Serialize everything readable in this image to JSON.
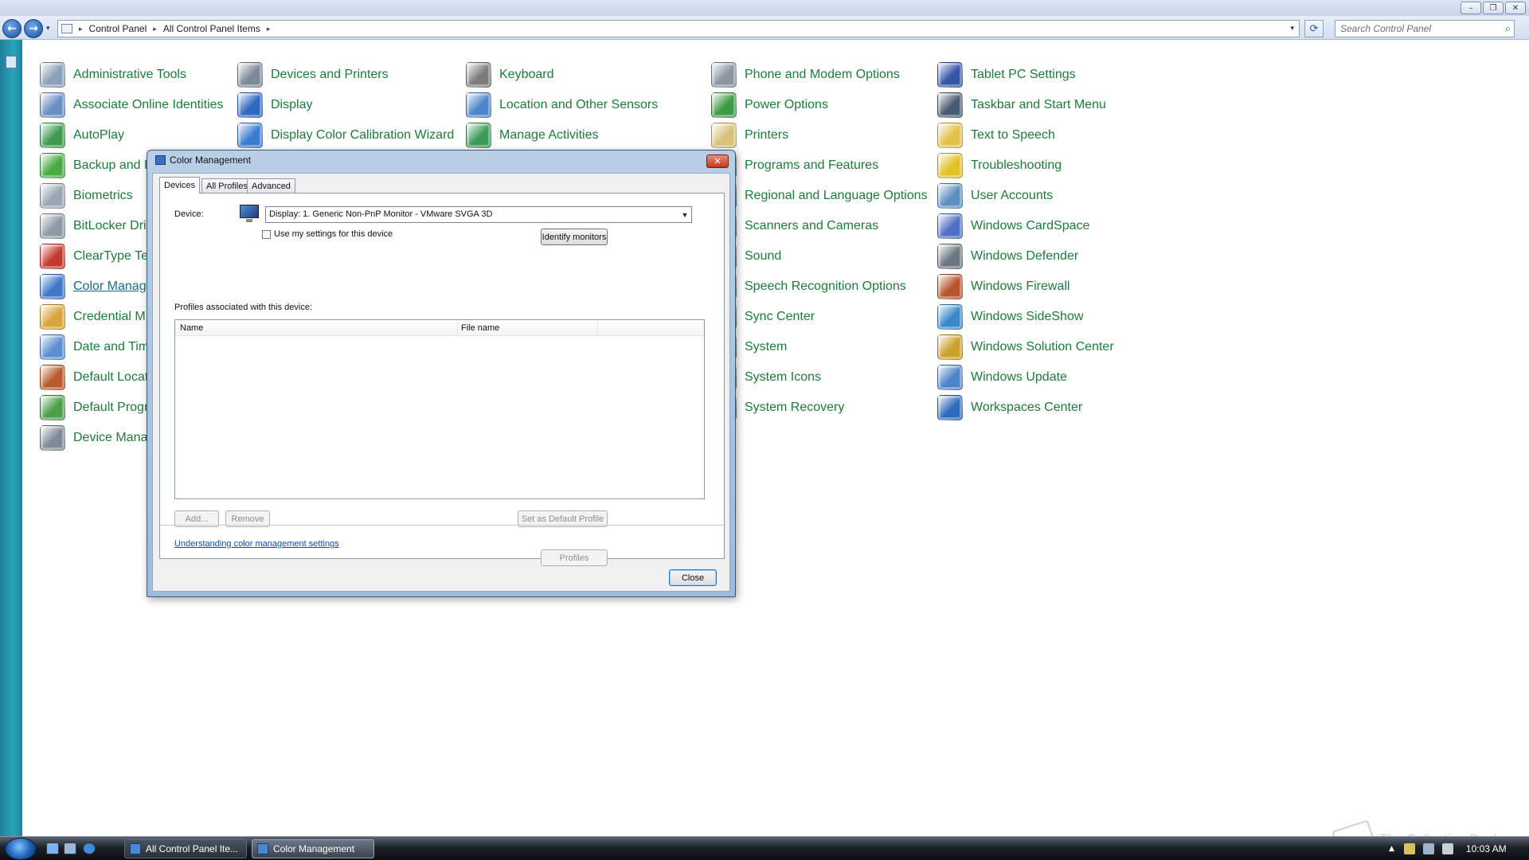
{
  "window": {
    "minimize_glyph": "–",
    "restore_glyph": "❐",
    "close_glyph": "✕"
  },
  "nav": {
    "back_glyph": "←",
    "forward_glyph": "→",
    "history_glyph": "▾",
    "breadcrumbs": [
      "Control Panel",
      "All Control Panel Items"
    ],
    "crumb_separator": "▸",
    "refresh_glyph": "⟳",
    "search_placeholder": "Search Control Panel",
    "search_icon": "search-icon",
    "search_glyph": "⌕"
  },
  "items": [
    {
      "label": "Administrative Tools",
      "icon": "administrative-tools-icon",
      "color": "#8aa1b9"
    },
    {
      "label": "Associate Online Identities",
      "icon": "online-identities-icon",
      "color": "#6a8fc2"
    },
    {
      "label": "AutoPlay",
      "icon": "autoplay-icon",
      "color": "#3f9c4f"
    },
    {
      "label": "Backup and R",
      "icon": "backup-icon",
      "color": "#4caa46"
    },
    {
      "label": "Biometrics",
      "icon": "biometrics-icon",
      "color": "#9aa6b3"
    },
    {
      "label": "BitLocker Dri",
      "icon": "bitlocker-icon",
      "color": "#8e9aa6"
    },
    {
      "label": "ClearType Te",
      "icon": "cleartype-icon",
      "color": "#c23a2e"
    },
    {
      "label": "Color Manag",
      "icon": "color-management-icon",
      "color": "#3f78c9"
    },
    {
      "label": "Credential M",
      "icon": "credential-manager-icon",
      "color": "#d7a53c"
    },
    {
      "label": "Date and Tim",
      "icon": "date-time-icon",
      "color": "#5c8fd1"
    },
    {
      "label": "Default Locat",
      "icon": "default-location-icon",
      "color": "#b85a2a"
    },
    {
      "label": "Default Progr",
      "icon": "default-programs-icon",
      "color": "#4b9f49"
    },
    {
      "label": "Device Mana",
      "icon": "device-manager-icon",
      "color": "#7f8b97"
    },
    {
      "label": "Devices and Printers",
      "icon": "devices-printers-icon",
      "color": "#7e8a98"
    },
    {
      "label": "Display",
      "icon": "display-icon",
      "color": "#2f68c0"
    },
    {
      "label": "Display Color Calibration Wizard",
      "icon": "color-calibration-icon",
      "color": "#3b7bd0"
    },
    {
      "label": "Keyboard",
      "icon": "keyboard-icon",
      "color": "#7c7c7c"
    },
    {
      "label": "Location and Other Sensors",
      "icon": "sensors-icon",
      "color": "#4b86c8"
    },
    {
      "label": "Manage Activities",
      "icon": "activities-icon",
      "color": "#3d9a5a"
    },
    {
      "label": "Phone and Modem Options",
      "icon": "phone-modem-icon",
      "color": "#8b96a2"
    },
    {
      "label": "Power Options",
      "icon": "power-options-icon",
      "color": "#3e9a45"
    },
    {
      "label": "Printers",
      "icon": "printers-icon",
      "color": "#d8c27a"
    },
    {
      "label": "Programs and Features",
      "icon": "programs-features-icon",
      "color": "#7f9ab6"
    },
    {
      "label": "Regional and Language Options",
      "icon": "regional-language-icon",
      "color": "#4a87c6"
    },
    {
      "label": "Scanners and Cameras",
      "icon": "scanners-cameras-icon",
      "color": "#8c8c8c"
    },
    {
      "label": "Sound",
      "icon": "sound-icon",
      "color": "#9aa3ad"
    },
    {
      "label": "Speech Recognition Options",
      "icon": "speech-recognition-icon",
      "color": "#6f9bd3"
    },
    {
      "label": "Sync Center",
      "icon": "sync-center-icon",
      "color": "#3aa44e"
    },
    {
      "label": "System",
      "icon": "system-icon",
      "color": "#5f7da3"
    },
    {
      "label": "System Icons",
      "icon": "system-icons-icon",
      "color": "#6d8db4"
    },
    {
      "label": "System Recovery",
      "icon": "system-recovery-icon",
      "color": "#4e88c6"
    },
    {
      "label": "Tablet PC Settings",
      "icon": "tablet-pc-icon",
      "color": "#3456a6"
    },
    {
      "label": "Taskbar and Start Menu",
      "icon": "taskbar-start-icon",
      "color": "#4a5a70"
    },
    {
      "label": "Text to Speech",
      "icon": "text-to-speech-icon",
      "color": "#e3c24c"
    },
    {
      "label": "Troubleshooting",
      "icon": "troubleshooting-icon",
      "color": "#e2c22a"
    },
    {
      "label": "User Accounts",
      "icon": "user-accounts-icon",
      "color": "#5f8fbf"
    },
    {
      "label": "Windows CardSpace",
      "icon": "cardspace-icon",
      "color": "#4d6fc4"
    },
    {
      "label": "Windows Defender",
      "icon": "defender-icon",
      "color": "#6c7680"
    },
    {
      "label": "Windows Firewall",
      "icon": "firewall-icon",
      "color": "#b8542e"
    },
    {
      "label": "Windows SideShow",
      "icon": "sideshow-icon",
      "color": "#3a88c8"
    },
    {
      "label": "Windows Solution Center",
      "icon": "solution-center-icon",
      "color": "#c9a22a"
    },
    {
      "label": "Windows Update",
      "icon": "windows-update-icon",
      "color": "#4d83c9"
    },
    {
      "label": "Workspaces Center",
      "icon": "workspaces-center-icon",
      "color": "#2f6bbd"
    }
  ],
  "dialog": {
    "title": "Color Management",
    "close_glyph": "✕",
    "tabs": [
      "Devices",
      "All Profiles",
      "Advanced"
    ],
    "active_tab": "Devices",
    "device_label": "Device:",
    "device_value": "Display: 1. Generic Non-PnP Monitor - VMware SVGA 3D",
    "combo_arrow": "▼",
    "use_my_settings_label": "Use my settings for this device",
    "use_my_settings_checked": false,
    "identify_button": "Identify monitors",
    "profiles_label": "Profiles associated with this device:",
    "columns": [
      "Name",
      "File name"
    ],
    "rows": [],
    "add_button": "Add...",
    "remove_button": "Remove",
    "set_default_button": "Set as Default Profile",
    "profiles_button": "Profiles",
    "help_link": "Understanding color management settings",
    "close_button": "Close"
  },
  "taskbar": {
    "quick_launch": [
      "show-desktop-icon",
      "switch-windows-icon",
      "internet-explorer-icon"
    ],
    "buttons": [
      {
        "label": "All Control Panel Ite...",
        "active": false
      },
      {
        "label": "Color Management",
        "active": true
      }
    ],
    "tray_expand_glyph": "▲",
    "clock": "10:03 AM"
  },
  "watermark": "The Collection Book"
}
